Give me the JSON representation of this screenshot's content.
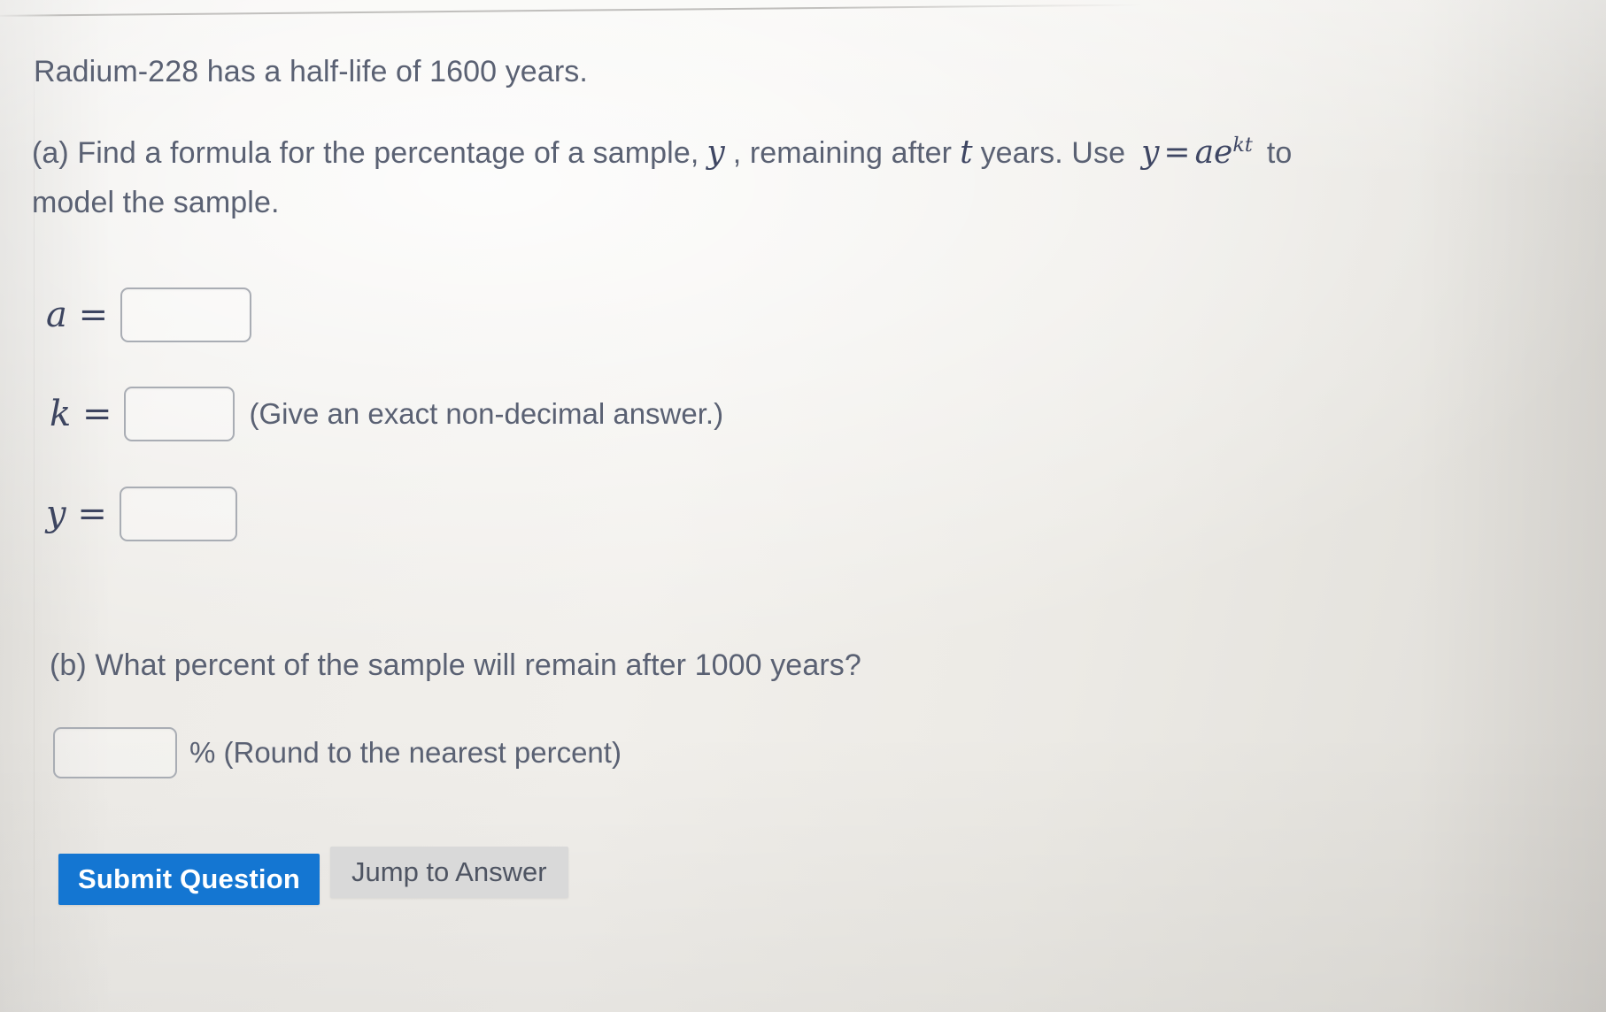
{
  "problem": {
    "statement": "Radium-228 has a half-life of 1600 years.",
    "part_a": {
      "line1_before_y": "(a) Find a formula for the percentage of a sample,",
      "var_y": "y",
      "line1_middle": ", remaining after",
      "var_t": "t",
      "line1_after_t": "years. Use",
      "formula_lhs": "y",
      "formula_eq": "=",
      "formula_rhs_base": "ae",
      "formula_rhs_exp": "kt",
      "line1_end": "to",
      "line2": "model the sample.",
      "fields": [
        {
          "label": "a",
          "equals": "=",
          "value": "",
          "note": ""
        },
        {
          "label": "k",
          "equals": "=",
          "value": "",
          "note": "(Give an exact non-decimal answer.)"
        },
        {
          "label": "y",
          "equals": "=",
          "value": "",
          "note": ""
        }
      ]
    },
    "part_b": {
      "question": "(b) What percent of the sample will remain after 1000 years?",
      "answer_value": "",
      "unit_note": "% (Round to the nearest percent)"
    }
  },
  "buttons": {
    "submit_label": "Submit Question",
    "jump_label": "Jump to Answer"
  },
  "colors": {
    "accent_blue": "#1476d2",
    "button_gray": "#d9d9d9",
    "text": "#5a6173",
    "math_text": "#3e4663",
    "input_border": "#a9adb4"
  }
}
